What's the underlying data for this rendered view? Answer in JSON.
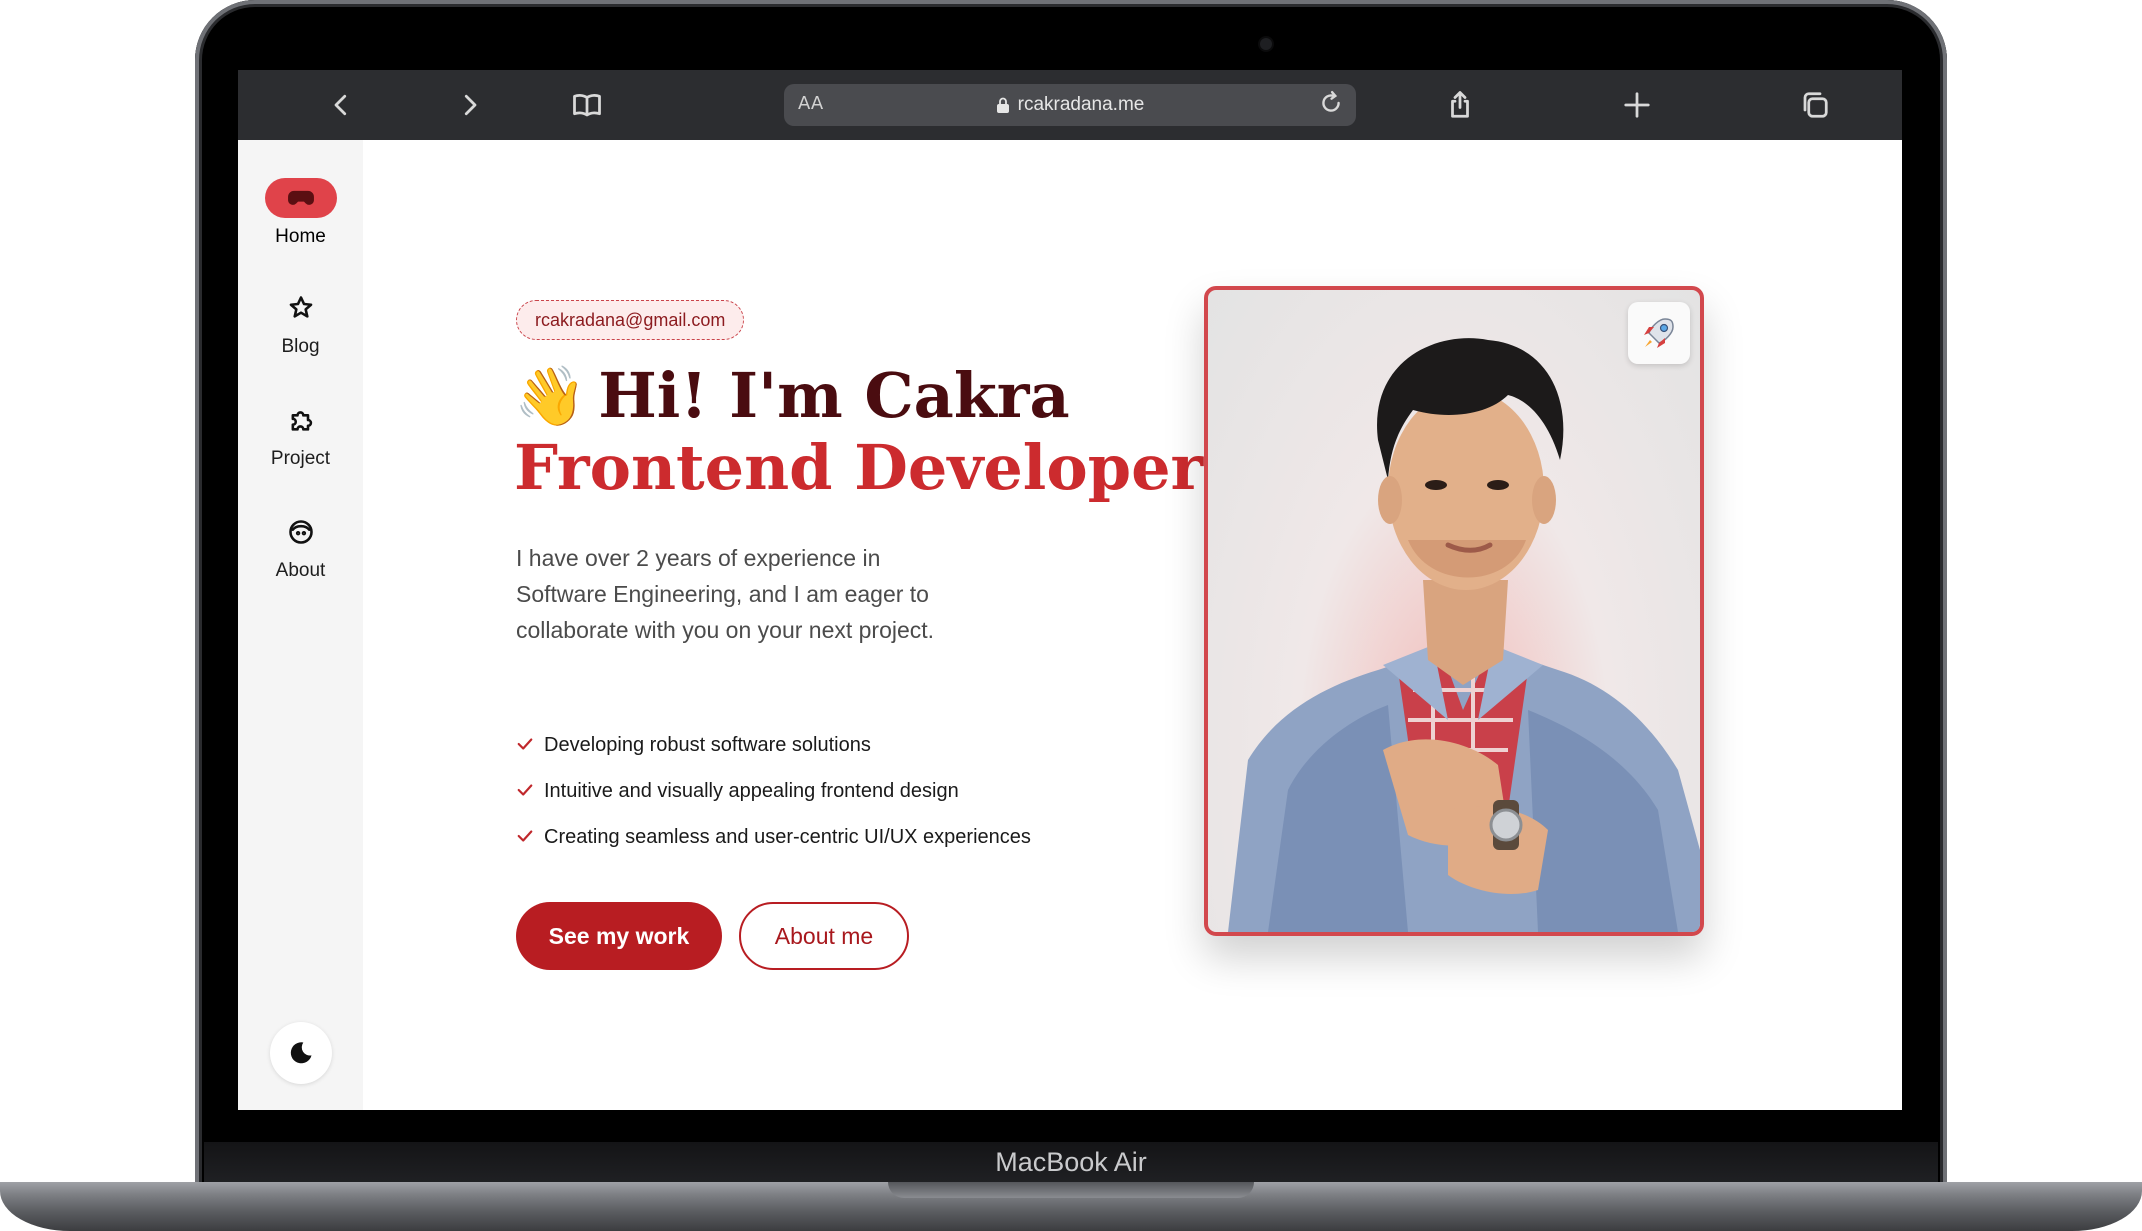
{
  "device": {
    "label": "MacBook Air"
  },
  "browser": {
    "text_size_label": "AA",
    "url": "rcakradana.me"
  },
  "sidebar": {
    "items": [
      {
        "label": "Home",
        "icon": "gamepad-icon",
        "active": true
      },
      {
        "label": "Blog",
        "icon": "star-icon",
        "active": false
      },
      {
        "label": "Project",
        "icon": "puzzle-icon",
        "active": false
      },
      {
        "label": "About",
        "icon": "face-icon",
        "active": false
      }
    ],
    "theme_icon": "moon-icon"
  },
  "hero": {
    "email": "rcakradana@gmail.com",
    "greeting": "Hi! I'm Cakra",
    "wave_emoji": "👋",
    "role": "Frontend Developer",
    "intro": "I have over 2 years of experience in Software Engineering, and I am eager to collaborate with you on your next project.",
    "features": [
      "Developing robust software solutions",
      "Intuitive and visually appealing frontend design",
      "Creating seamless and user-centric UI/UX experiences"
    ],
    "primary_button": "See my work",
    "secondary_button": "About me",
    "photo_action_icon": "rocket-icon"
  },
  "colors": {
    "accent": "#b81d22",
    "accent_light": "#e0434a",
    "heading_dark": "#4a0c10",
    "browser_bar": "#2c2d30"
  }
}
